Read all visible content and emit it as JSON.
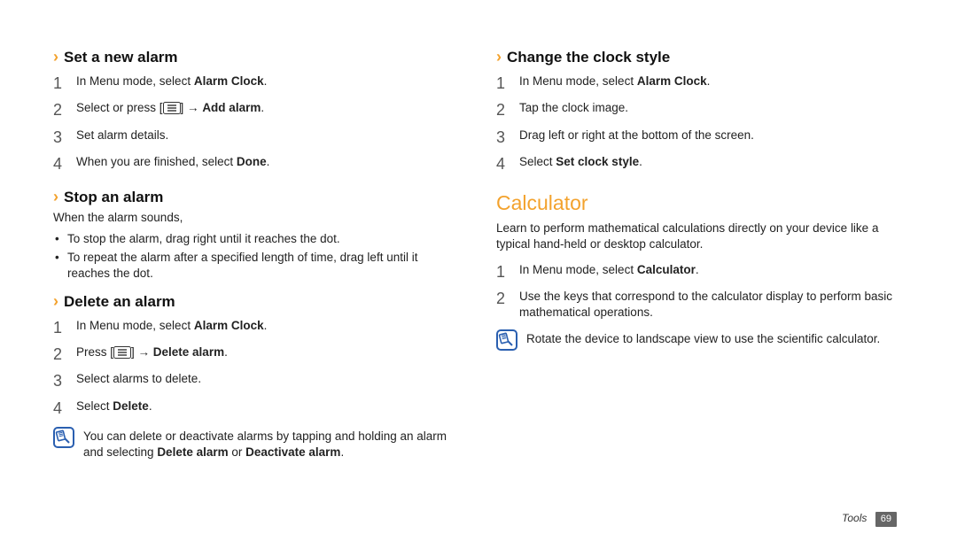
{
  "left": {
    "s1": {
      "title": "Set a new alarm",
      "steps": [
        {
          "n": "1",
          "pre": "In Menu mode, select ",
          "bold": "Alarm Clock",
          "post": "."
        },
        {
          "n": "2",
          "pre": "Select        or press [",
          "menukey": true,
          "mid": "] → ",
          "bold": "Add alarm",
          "post": "."
        },
        {
          "n": "3",
          "pre": "Set alarm details."
        },
        {
          "n": "4",
          "pre": "When you are finished, select ",
          "bold": "Done",
          "post": "."
        }
      ]
    },
    "s2": {
      "title": "Stop an alarm",
      "intro": "When the alarm sounds,",
      "b1": "To stop the alarm, drag        right until it reaches the dot.",
      "b2": "To repeat the alarm after a specified length of time, drag        left until it reaches the dot."
    },
    "s3": {
      "title": "Delete an alarm",
      "steps": [
        {
          "n": "1",
          "pre": "In Menu mode, select ",
          "bold": "Alarm Clock",
          "post": "."
        },
        {
          "n": "2",
          "pre": "Press [",
          "menukey": true,
          "mid": "] → ",
          "bold": "Delete alarm",
          "post": "."
        },
        {
          "n": "3",
          "pre": "Select alarms to delete."
        },
        {
          "n": "4",
          "pre": "Select ",
          "bold": "Delete",
          "post": "."
        }
      ],
      "noteA": "You can delete or deactivate alarms by tapping and holding an alarm and selecting ",
      "noteB1": "Delete alarm",
      "noteMid": " or ",
      "noteB2": "Deactivate alarm",
      "noteEnd": "."
    }
  },
  "right": {
    "s1": {
      "title": "Change the clock style",
      "steps": [
        {
          "n": "1",
          "pre": "In Menu mode, select ",
          "bold": "Alarm Clock",
          "post": "."
        },
        {
          "n": "2",
          "pre": "Tap the clock image."
        },
        {
          "n": "3",
          "pre": "Drag left or right at the bottom of the screen."
        },
        {
          "n": "4",
          "pre": "Select ",
          "bold": "Set clock style",
          "post": "."
        }
      ]
    },
    "calc": {
      "title": "Calculator",
      "intro": "Learn to perform mathematical calculations directly on your device like a typical hand-held or desktop calculator.",
      "steps": [
        {
          "n": "1",
          "pre": "In Menu mode, select ",
          "bold": "Calculator",
          "post": "."
        },
        {
          "n": "2",
          "pre": "Use the keys that correspond to the calculator display to perform basic mathematical operations."
        }
      ],
      "note": "Rotate the device to landscape view to use the scientific calculator."
    }
  },
  "footer": {
    "section": "Tools",
    "page": "69"
  }
}
